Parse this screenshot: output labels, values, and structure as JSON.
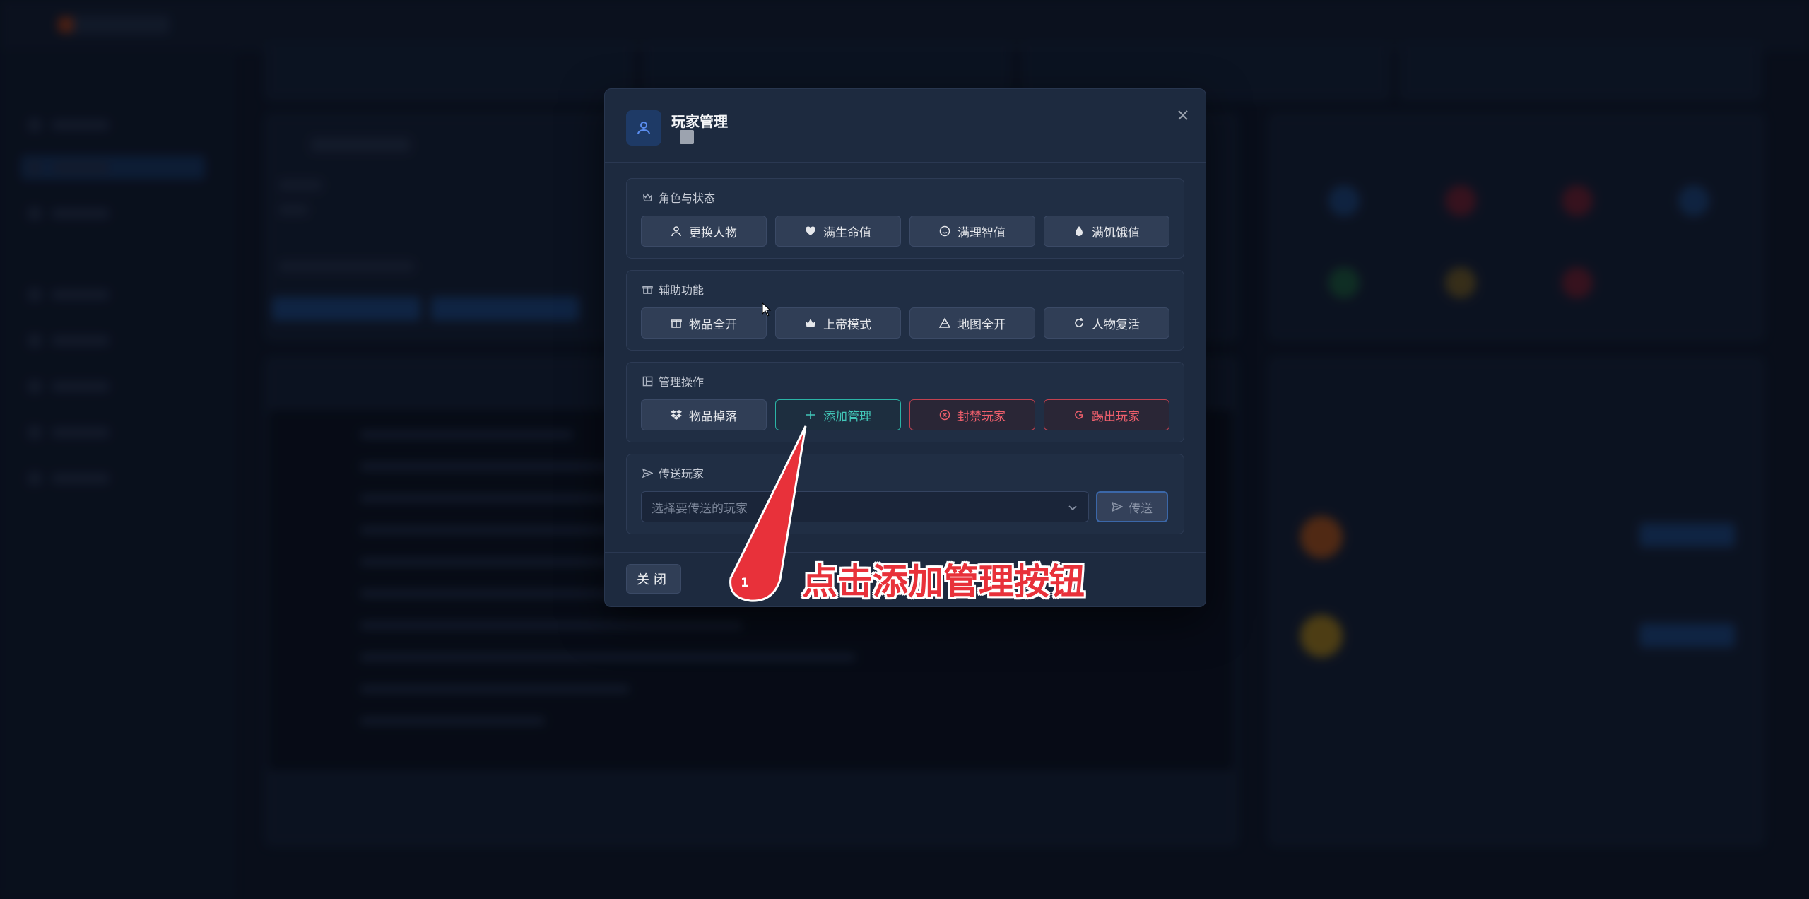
{
  "modal": {
    "title": "玩家管理",
    "close_icon": "close-icon",
    "sections": {
      "role": {
        "title": "角色与状态",
        "icon": "crown-icon",
        "buttons": [
          "更换人物",
          "满生命值",
          "满理智值",
          "满饥饿值"
        ]
      },
      "assist": {
        "title": "辅助功能",
        "icon": "gift-icon",
        "buttons": [
          "物品全开",
          "上帝模式",
          "地图全开",
          "人物复活"
        ]
      },
      "admin": {
        "title": "管理操作",
        "icon": "grid-icon",
        "buttons": [
          "物品掉落",
          "添加管理",
          "封禁玩家",
          "踢出玩家"
        ]
      },
      "teleport": {
        "title": "传送玩家",
        "icon": "send-icon",
        "select_placeholder": "选择要传送的玩家",
        "send_label": "传送"
      }
    },
    "footer": {
      "close_label": "关闭"
    }
  },
  "annotation": {
    "step_number": "1",
    "text": "点击添加管理按钮",
    "color": "#e8313a"
  },
  "colors": {
    "teal_accent": "#2bb4a6",
    "danger": "#ef5f6c",
    "modal_bg": "#1d2a3f"
  }
}
